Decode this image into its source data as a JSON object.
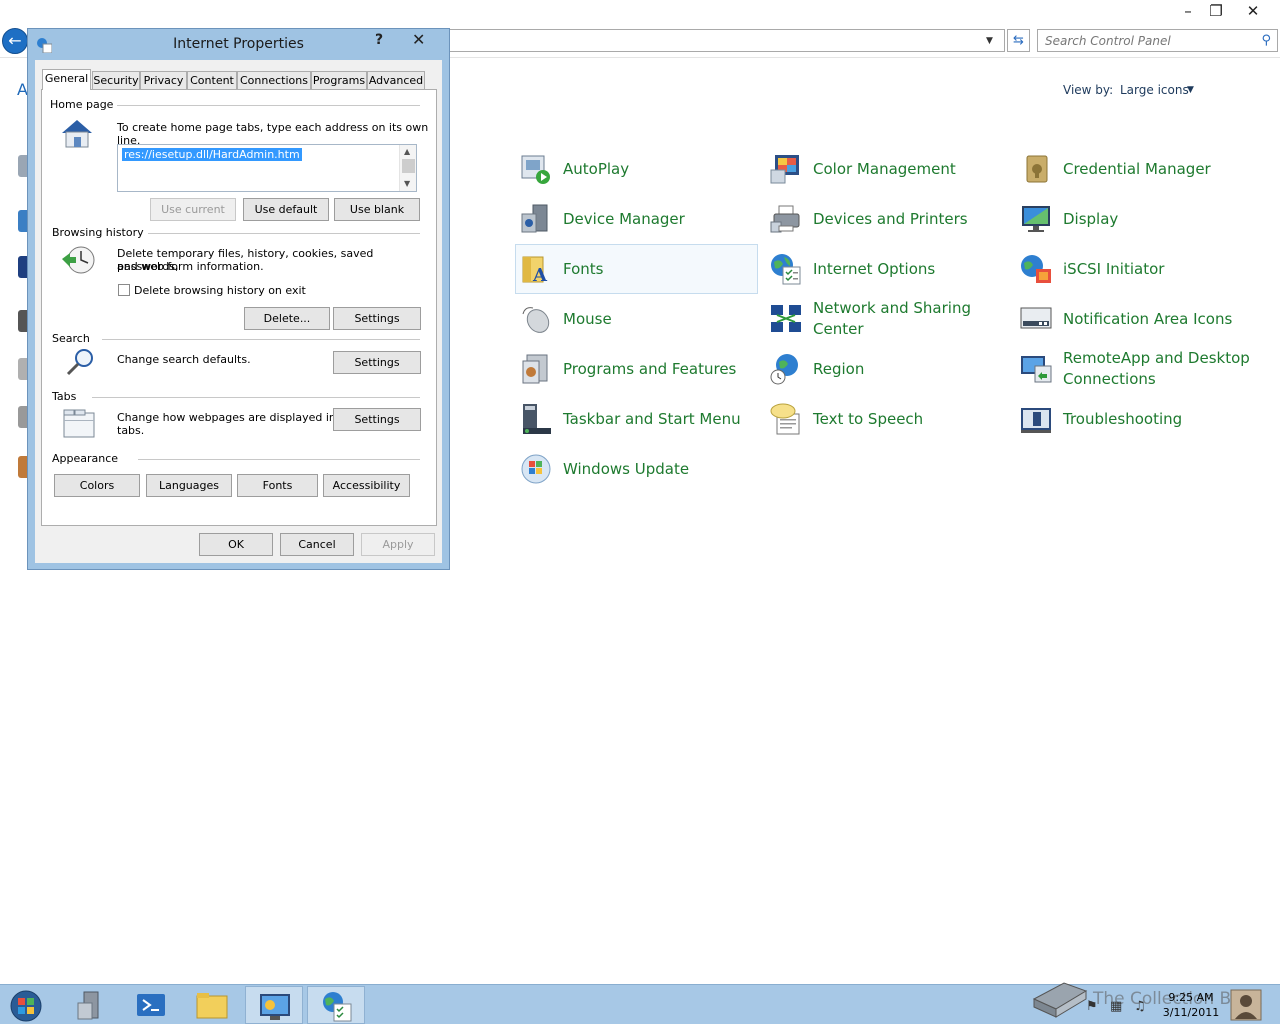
{
  "window": {
    "search_placeholder": "Search Control Panel",
    "crumb_fragment": "A",
    "view_by_label": "View by:",
    "view_by_value": "Large icons"
  },
  "items": [
    {
      "label": "AutoPlay",
      "icon": "autoplay-icon"
    },
    {
      "label": "Color Management",
      "icon": "color-management-icon"
    },
    {
      "label": "Credential Manager",
      "icon": "credential-manager-icon"
    },
    {
      "label": "Device Manager",
      "icon": "device-manager-icon"
    },
    {
      "label": "Devices and Printers",
      "icon": "devices-printers-icon"
    },
    {
      "label": "Display",
      "icon": "display-icon"
    },
    {
      "label": "Fonts",
      "icon": "fonts-icon"
    },
    {
      "label": "Internet Options",
      "icon": "internet-options-icon"
    },
    {
      "label": "iSCSI Initiator",
      "icon": "iscsi-icon"
    },
    {
      "label": "Mouse",
      "icon": "mouse-icon"
    },
    {
      "label": "Network and Sharing Center",
      "icon": "network-icon"
    },
    {
      "label": "Notification Area Icons",
      "icon": "notification-icon"
    },
    {
      "label": "Programs and Features",
      "icon": "programs-icon"
    },
    {
      "label": "Region",
      "icon": "region-icon"
    },
    {
      "label": "RemoteApp and Desktop Connections",
      "icon": "remoteapp-icon"
    },
    {
      "label": "Taskbar and Start Menu",
      "icon": "taskbar-icon"
    },
    {
      "label": "Text to Speech",
      "icon": "speech-icon"
    },
    {
      "label": "Troubleshooting",
      "icon": "troubleshooting-icon"
    },
    {
      "label": "Windows Update",
      "icon": "windows-update-icon"
    }
  ],
  "dialog": {
    "title": "Internet Properties",
    "help": "?",
    "close": "✕",
    "tabs": [
      "General",
      "Security",
      "Privacy",
      "Content",
      "Connections",
      "Programs",
      "Advanced"
    ],
    "home_page": {
      "group": "Home page",
      "description": "To create home page tabs, type each address on its own line.",
      "url": "res://iesetup.dll/HardAdmin.htm",
      "use_current": "Use current",
      "use_default": "Use default",
      "use_blank": "Use blank"
    },
    "browsing_history": {
      "group": "Browsing history",
      "description_1": "Delete temporary files, history, cookies, saved passwords,",
      "description_2": "and web form information.",
      "checkbox": "Delete browsing history on exit",
      "delete": "Delete...",
      "settings": "Settings"
    },
    "search": {
      "group": "Search",
      "description": "Change search defaults.",
      "settings": "Settings"
    },
    "tabs_section": {
      "group": "Tabs",
      "description_1": "Change how webpages are displayed in",
      "description_2": "tabs.",
      "settings": "Settings"
    },
    "appearance": {
      "group": "Appearance",
      "colors": "Colors",
      "languages": "Languages",
      "fonts": "Fonts",
      "accessibility": "Accessibility"
    },
    "ok": "OK",
    "cancel": "Cancel",
    "apply": "Apply"
  },
  "taskbar": {
    "time": "9:25 AM",
    "date": "3/11/2011",
    "watermark": "The Collection Book"
  }
}
